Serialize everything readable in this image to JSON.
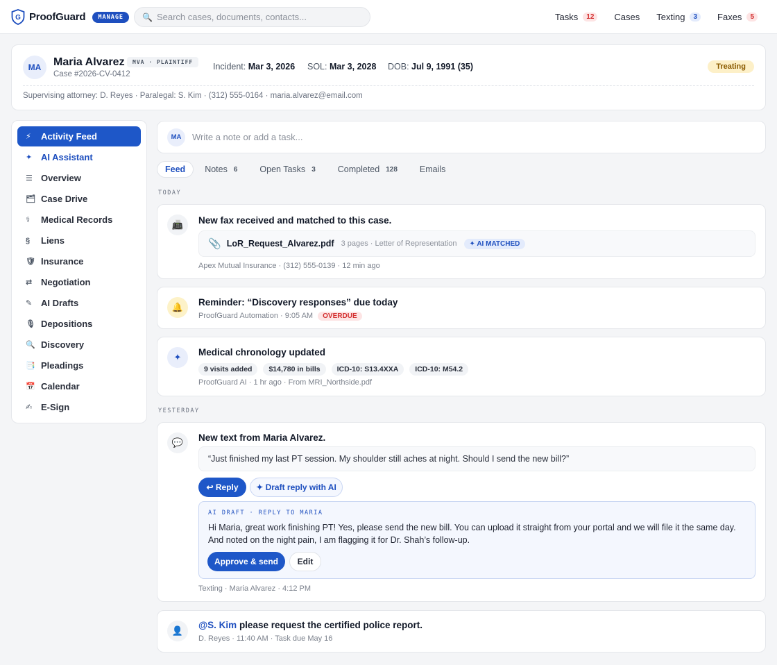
{
  "app": {
    "brand": "ProofGuard",
    "badge": "MANAGE",
    "search_placeholder": "Search cases, documents, contacts..."
  },
  "topnav": [
    {
      "label": "Tasks",
      "count": "12",
      "color": "red"
    },
    {
      "label": "Cases",
      "count": null
    },
    {
      "label": "Texting",
      "count": "3",
      "color": "blue"
    },
    {
      "label": "Faxes",
      "count": "5",
      "color": "red"
    }
  ],
  "case": {
    "initials": "MA",
    "name": "Maria Alvarez",
    "tag": "MVA · PLAINTIFF",
    "number": "Case #2026-CV-0412",
    "incident_label": "Incident:",
    "incident": "Mar 3, 2026",
    "sol_label": "SOL:",
    "sol": "Mar 3, 2028",
    "dob_label": "DOB:",
    "dob": "Jul 9, 1991 (35)",
    "status": "Treating",
    "contacts": "Supervising attorney: D. Reyes · Paralegal: S. Kim · (312) 555-0164 · maria.alvarez@email.com"
  },
  "sidebar": {
    "items": [
      {
        "label": "Activity Feed",
        "icon": "lightning-icon",
        "glyph": "⚡"
      },
      {
        "label": "AI Assistant",
        "icon": "sparkle-icon",
        "glyph": "✦"
      },
      {
        "label": "Overview",
        "icon": "menu-icon",
        "glyph": "☰"
      },
      {
        "label": "Case Drive",
        "icon": "folder-icon",
        "glyph": "🗂"
      },
      {
        "label": "Medical Records",
        "icon": "caduceus-icon",
        "glyph": "⚕"
      },
      {
        "label": "Liens",
        "icon": "section-icon",
        "glyph": "§"
      },
      {
        "label": "Insurance",
        "icon": "shield-icon",
        "glyph": "🛡"
      },
      {
        "label": "Negotiation",
        "icon": "swap-icon",
        "glyph": "⇄"
      },
      {
        "label": "AI Drafts",
        "icon": "pencil-icon",
        "glyph": "✎"
      },
      {
        "label": "Depositions",
        "icon": "microphone-icon",
        "glyph": "🎙"
      },
      {
        "label": "Discovery",
        "icon": "magnifier-icon",
        "glyph": "🔍"
      },
      {
        "label": "Pleadings",
        "icon": "document-icon",
        "glyph": "📑"
      },
      {
        "label": "Calendar",
        "icon": "calendar-icon",
        "glyph": "📅"
      },
      {
        "label": "E-Sign",
        "icon": "signature-icon",
        "glyph": "✍"
      }
    ]
  },
  "compose": {
    "initials": "MA",
    "placeholder": "Write a note or add a task..."
  },
  "tabs": [
    {
      "label": "Feed",
      "count": ""
    },
    {
      "label": "Notes",
      "count": "6"
    },
    {
      "label": "Open Tasks",
      "count": "3"
    },
    {
      "label": "Completed",
      "count": "128"
    },
    {
      "label": "Emails",
      "count": ""
    }
  ],
  "feed": {
    "today_label": "TODAY",
    "yesterday_label": "YESTERDAY",
    "fax": {
      "icon": "fax-icon",
      "title": "New fax received and matched to this case.",
      "file": "LoR_Request_Alvarez.pdf",
      "file_meta": "3 pages · Letter of Representation",
      "matched": "✦ AI MATCHED",
      "sub": "Apex Mutual Insurance · (312) 555-0139 · 12 min ago"
    },
    "reminder": {
      "icon": "bell-icon",
      "title": "Reminder: “Discovery responses” due today",
      "sub": "ProofGuard Automation · 9:05 AM",
      "badge": "OVERDUE"
    },
    "chronology": {
      "icon": "sparkle-icon",
      "title": "Medical chronology updated",
      "chips": [
        "9 visits added",
        "$14,780 in bills",
        "ICD-10: S13.4XXA",
        "ICD-10: M54.2"
      ],
      "sub": "ProofGuard AI · 1 hr ago · From MRI_Northside.pdf"
    },
    "text": {
      "icon": "speech-bubble-icon",
      "title": "New text from Maria Alvarez.",
      "quote": "“Just finished my last PT session. My shoulder still aches at night. Should I send the new bill?”",
      "reply": "↩ Reply",
      "draft_ai": "✦ Draft reply with AI",
      "draft_label": "AI DRAFT · REPLY TO MARIA",
      "draft_text": "Hi Maria, great work finishing PT! Yes, please send the new bill. You can upload it straight from your portal and we will file it the same day. And noted on the night pain, I am flagging it for Dr. Shah’s follow-up.",
      "approve": "Approve & send",
      "edit": "Edit",
      "sub": "Texting · Maria Alvarez · 4:12 PM"
    },
    "task": {
      "icon": "person-icon",
      "mention": "@S. Kim",
      "title_rest": " please request the certified police report.",
      "sub": "D. Reyes · 11:40 AM · Task due May 16"
    }
  },
  "colors": {
    "accent": "#1e57c8",
    "danger": "#d32f2f",
    "status_bg": "#fdf0c8"
  }
}
